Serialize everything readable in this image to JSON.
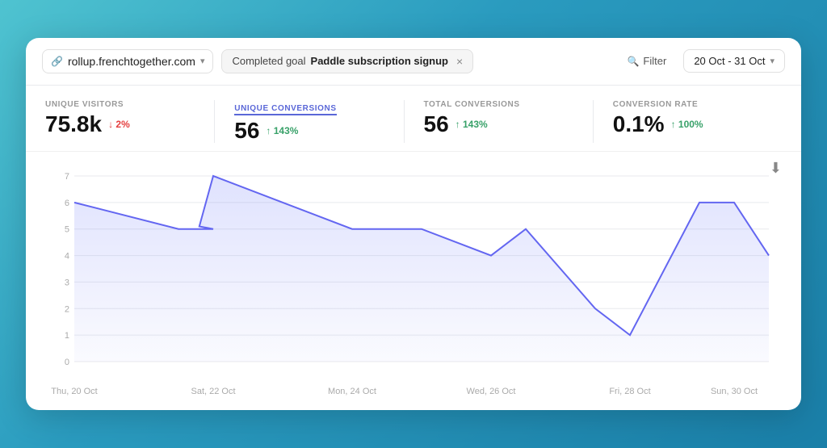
{
  "toolbar": {
    "site": "rollup.frenchtogether.com",
    "site_chevron": "▾",
    "link_icon": "🔗",
    "goal_label": "Completed goal",
    "goal_name": "Paddle subscription signup",
    "close_label": "×",
    "filter_label": "Filter",
    "search_icon": "🔍",
    "date_range": "20 Oct - 31 Oct",
    "chevron_icon": "▾"
  },
  "metrics": [
    {
      "label": "UNIQUE VISITORS",
      "value": "75.8k",
      "change": "↓ 2%",
      "change_type": "down",
      "active": false
    },
    {
      "label": "UNIQUE CONVERSIONS",
      "value": "56",
      "change": "↑ 143%",
      "change_type": "up",
      "active": true
    },
    {
      "label": "TOTAL CONVERSIONS",
      "value": "56",
      "change": "↑ 143%",
      "change_type": "up",
      "active": false
    },
    {
      "label": "CONVERSION RATE",
      "value": "0.1%",
      "change": "↑ 100%",
      "change_type": "up",
      "active": false
    }
  ],
  "chart": {
    "x_labels": [
      "Thu, 20 Oct",
      "Sat, 22 Oct",
      "Mon, 24 Oct",
      "Wed, 26 Oct",
      "Fri, 28 Oct",
      "Sun, 30 Oct"
    ],
    "y_labels": [
      "0",
      "1",
      "2",
      "3",
      "4",
      "5",
      "6",
      "7"
    ],
    "data_points": [
      6,
      5,
      7,
      5,
      5,
      4,
      2,
      1,
      6,
      6,
      4
    ]
  },
  "download_icon": "⬇"
}
